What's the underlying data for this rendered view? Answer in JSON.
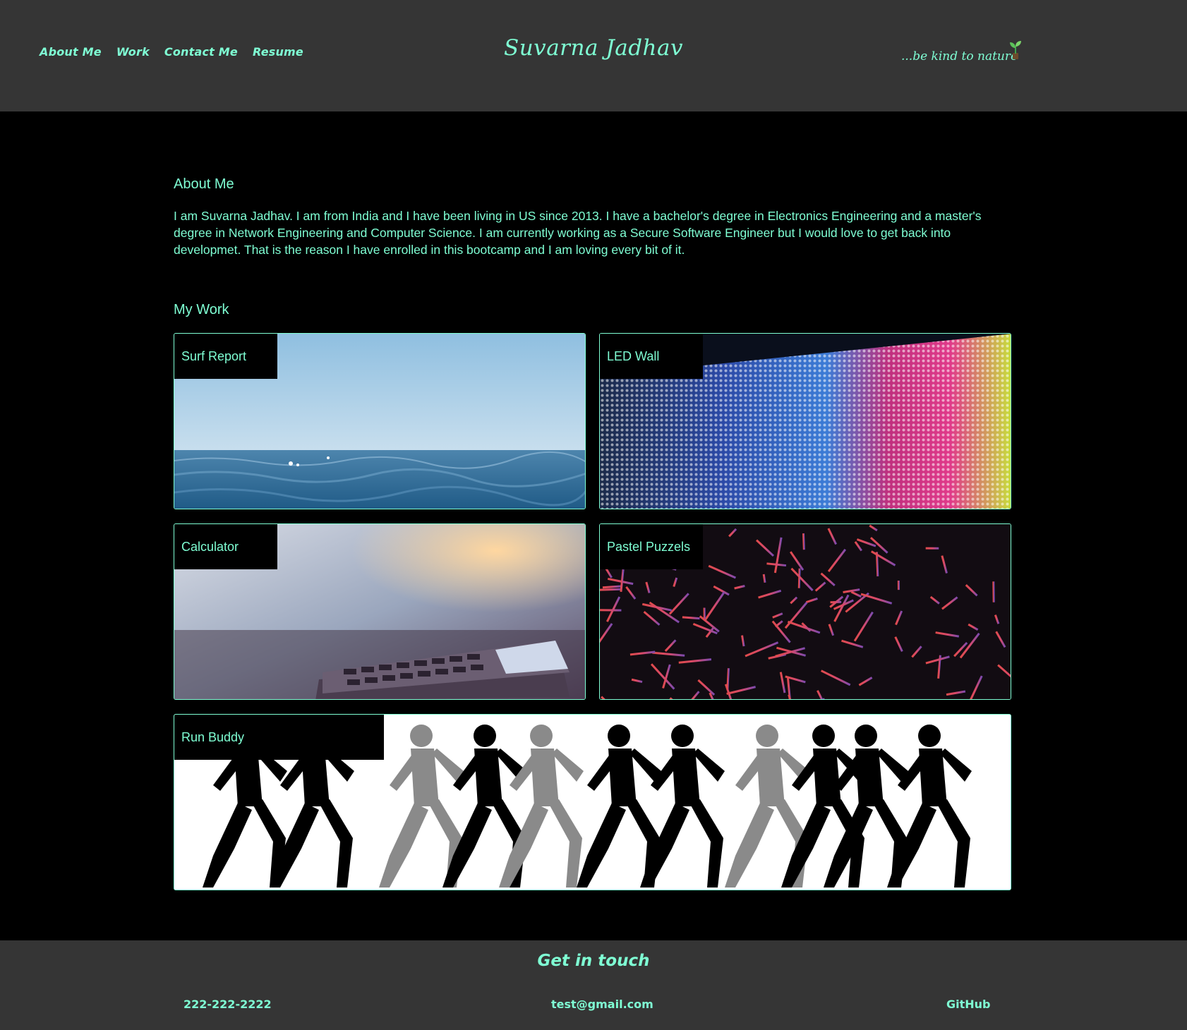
{
  "header": {
    "nav": [
      "About Me",
      "Work",
      "Contact Me",
      "Resume"
    ],
    "brand": "Suvarna Jadhav",
    "tagline": "...be kind to nature",
    "tagline_icon": "seedling-icon"
  },
  "about": {
    "title": "About Me",
    "text": "I am Suvarna Jadhav. I am from India and I have been living in US since 2013. I have a bachelor's degree in Electronics Engineering and a master's degree in Network Engineering and Computer Science. I am currently working as a Secure Software Engineer but I would love to get back into developmet. That is the reason I have enrolled in this bootcamp and I am loving every bit of it."
  },
  "work": {
    "title": "My Work",
    "projects": [
      {
        "name": "Surf Report",
        "image": "ocean-waves"
      },
      {
        "name": "LED Wall",
        "image": "led-panel"
      },
      {
        "name": "Calculator",
        "image": "calculator-desk"
      },
      {
        "name": "Pastel Puzzels",
        "image": "confetti-lines"
      },
      {
        "name": "Run Buddy",
        "image": "runners-silhouette"
      }
    ]
  },
  "footer": {
    "title": "Get in touch",
    "phone": "222-222-2222",
    "email": "test@gmail.com",
    "github": "GitHub"
  },
  "colors": {
    "accent": "#7fffd4",
    "header_bg": "#353535",
    "page_bg": "#000000"
  }
}
